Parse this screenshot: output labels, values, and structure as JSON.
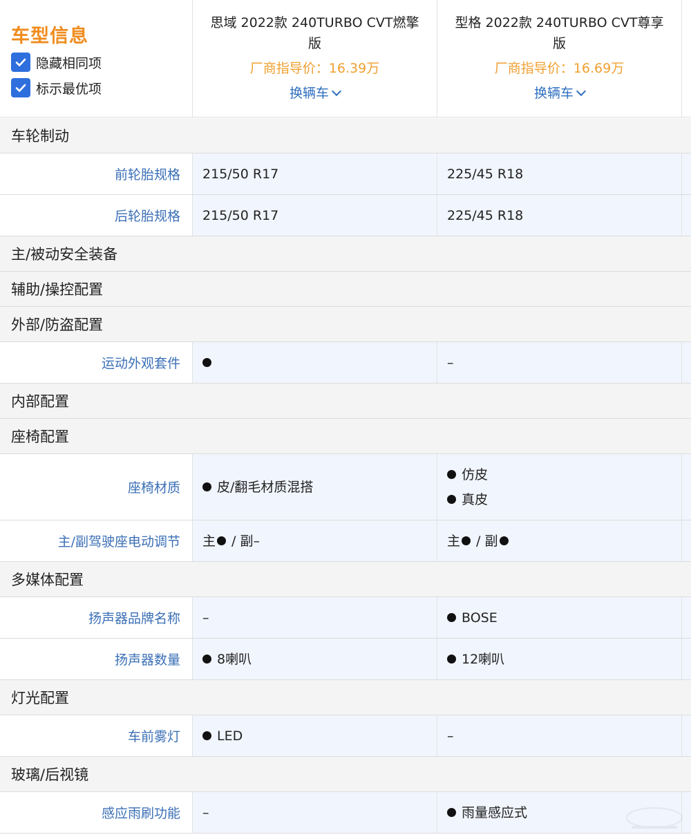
{
  "header": {
    "title": "车型信息",
    "options": [
      {
        "label": "隐藏相同项",
        "checked": true
      },
      {
        "label": "标示最优项",
        "checked": true
      }
    ],
    "cars": [
      {
        "name": "思域 2022款 240TURBO CVT燃擎版",
        "price": "厂商指导价：16.39万",
        "switch_label": "换辆车"
      },
      {
        "name": "型格 2022款 240TURBO CVT尊享版",
        "price": "厂商指导价：16.69万",
        "switch_label": "换辆车"
      }
    ]
  },
  "sections": {
    "wheels": "车轮制动",
    "safety": "主/被动安全装备",
    "assist": "辅助/操控配置",
    "exterior": "外部/防盗配置",
    "interior": "内部配置",
    "seats": "座椅配置",
    "multimedia": "多媒体配置",
    "lights": "灯光配置",
    "glass": "玻璃/后视镜"
  },
  "rows": {
    "front_tire": {
      "label": "前轮胎规格",
      "car1": "215/50 R17",
      "car2": "225/45 R18"
    },
    "rear_tire": {
      "label": "后轮胎规格",
      "car1": "215/50 R17",
      "car2": "225/45 R18"
    },
    "sport_kit": {
      "label": "运动外观套件",
      "car1": "",
      "car2": "–"
    },
    "seat_material": {
      "label": "座椅材质",
      "car1": "皮/翻毛材质混搭",
      "car2_a": "仿皮",
      "car2_b": "真皮"
    },
    "power_seat": {
      "label": "主/副驾驶座电动调节",
      "main": "主",
      "sep": " / ",
      "passenger": "副",
      "dash": "–"
    },
    "speaker_brand": {
      "label": "扬声器品牌名称",
      "car1": "–",
      "car2": "BOSE"
    },
    "speaker_count": {
      "label": "扬声器数量",
      "car1": "8喇叭",
      "car2": "12喇叭"
    },
    "fog_light": {
      "label": "车前雾灯",
      "car1": "LED",
      "car2": "–"
    },
    "rain_wiper": {
      "label": "感应雨刷功能",
      "car1": "–",
      "car2": "雨量感应式"
    }
  },
  "colors": {
    "accent_orange": "#f08c1e",
    "price_orange": "#f0a030",
    "link_blue": "#3b6fb6",
    "check_blue": "#2f6fdd"
  }
}
